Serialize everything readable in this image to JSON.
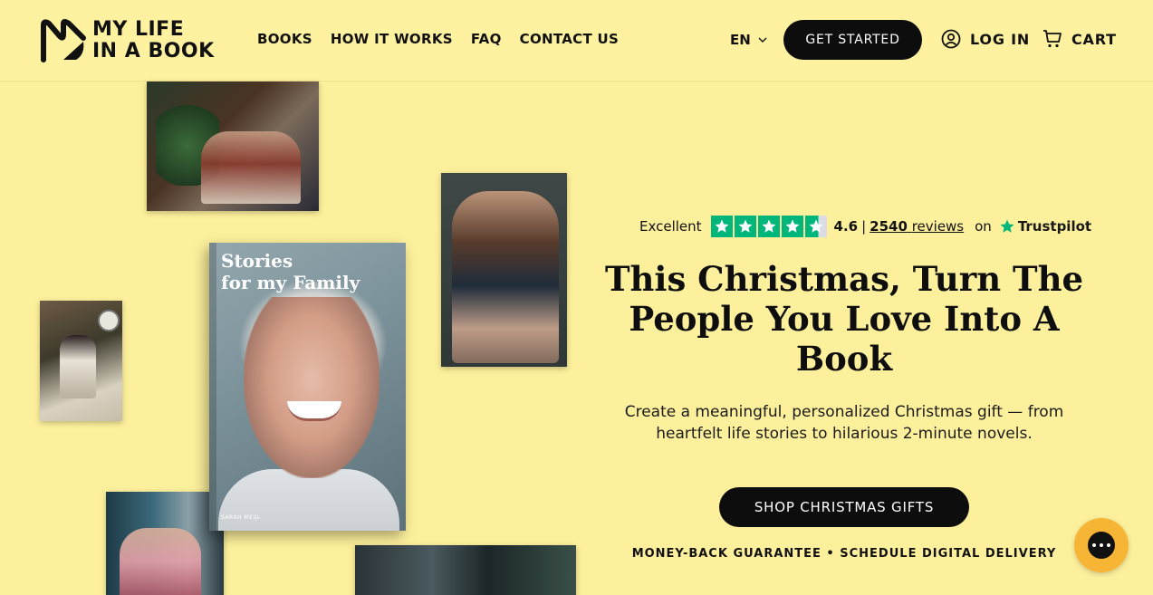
{
  "brand": {
    "line1": "MY LIFE",
    "line2": "IN A BOOK"
  },
  "nav": {
    "items": [
      {
        "label": "BOOKS"
      },
      {
        "label": "HOW IT WORKS"
      },
      {
        "label": "FAQ"
      },
      {
        "label": "CONTACT US"
      }
    ]
  },
  "header": {
    "language": "EN",
    "get_started": "GET STARTED",
    "login": "LOG IN",
    "cart": "CART"
  },
  "book": {
    "title_line1": "Stories",
    "title_line2": "for my Family",
    "author": "SARAH MEIJL"
  },
  "rating": {
    "label": "Excellent",
    "score": "4.6",
    "separator": "|",
    "review_count": "2540",
    "reviews_word": "reviews",
    "on": "on",
    "provider": "Trustpilot",
    "stars": 4.6,
    "star_color": "#00b67a"
  },
  "hero": {
    "headline": "This Christmas, Turn The People You Love Into A Book",
    "subtext": "Create a meaningful, personalized Christmas gift — from heartfelt life stories to hilarious 2-minute novels.",
    "cta": "SHOP CHRISTMAS GIFTS",
    "guarantee": "MONEY-BACK GUARANTEE • SCHEDULE DIGITAL DELIVERY"
  },
  "colors": {
    "background": "#fdf09c",
    "button_dark": "#0d0d0d",
    "chat_bubble": "#f7b535"
  }
}
